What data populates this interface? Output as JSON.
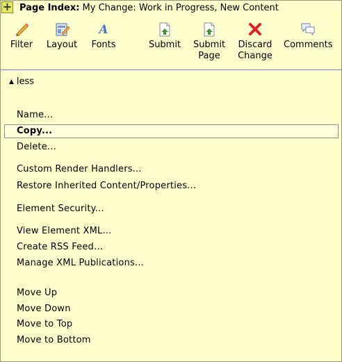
{
  "titlebar": {
    "plus": "+",
    "label": "Page Index:",
    "subtitle": "My Change: Work in Progress, New Content"
  },
  "toolbar": [
    {
      "label": "Filter",
      "icon": "pencil-icon"
    },
    {
      "label": "Layout",
      "icon": "layout-icon"
    },
    {
      "label": "Fonts",
      "icon": "font-icon"
    },
    {
      "label": "Submit",
      "icon": "submit-icon"
    },
    {
      "label": "Submit\nPage",
      "icon": "submit-page-icon"
    },
    {
      "label": "Discard\nChange",
      "icon": "discard-icon"
    },
    {
      "label": "Comments",
      "icon": "comments-icon"
    }
  ],
  "less_label": "less",
  "menu": [
    "Name...",
    "Copy...",
    "Delete...",
    "Custom Render Handlers...",
    "Restore Inherited Content/Properties...",
    "Element Security...",
    "View Element XML...",
    "Create RSS Feed...",
    "Manage XML Publications...",
    "Move Up",
    "Move Down",
    "Move to Top",
    "Move to Bottom"
  ],
  "colors": {
    "panel_bg": "#ffffc8",
    "accent_red": "#e02020",
    "accent_green": "#3a9a2a",
    "accent_blue": "#4a78c8"
  }
}
